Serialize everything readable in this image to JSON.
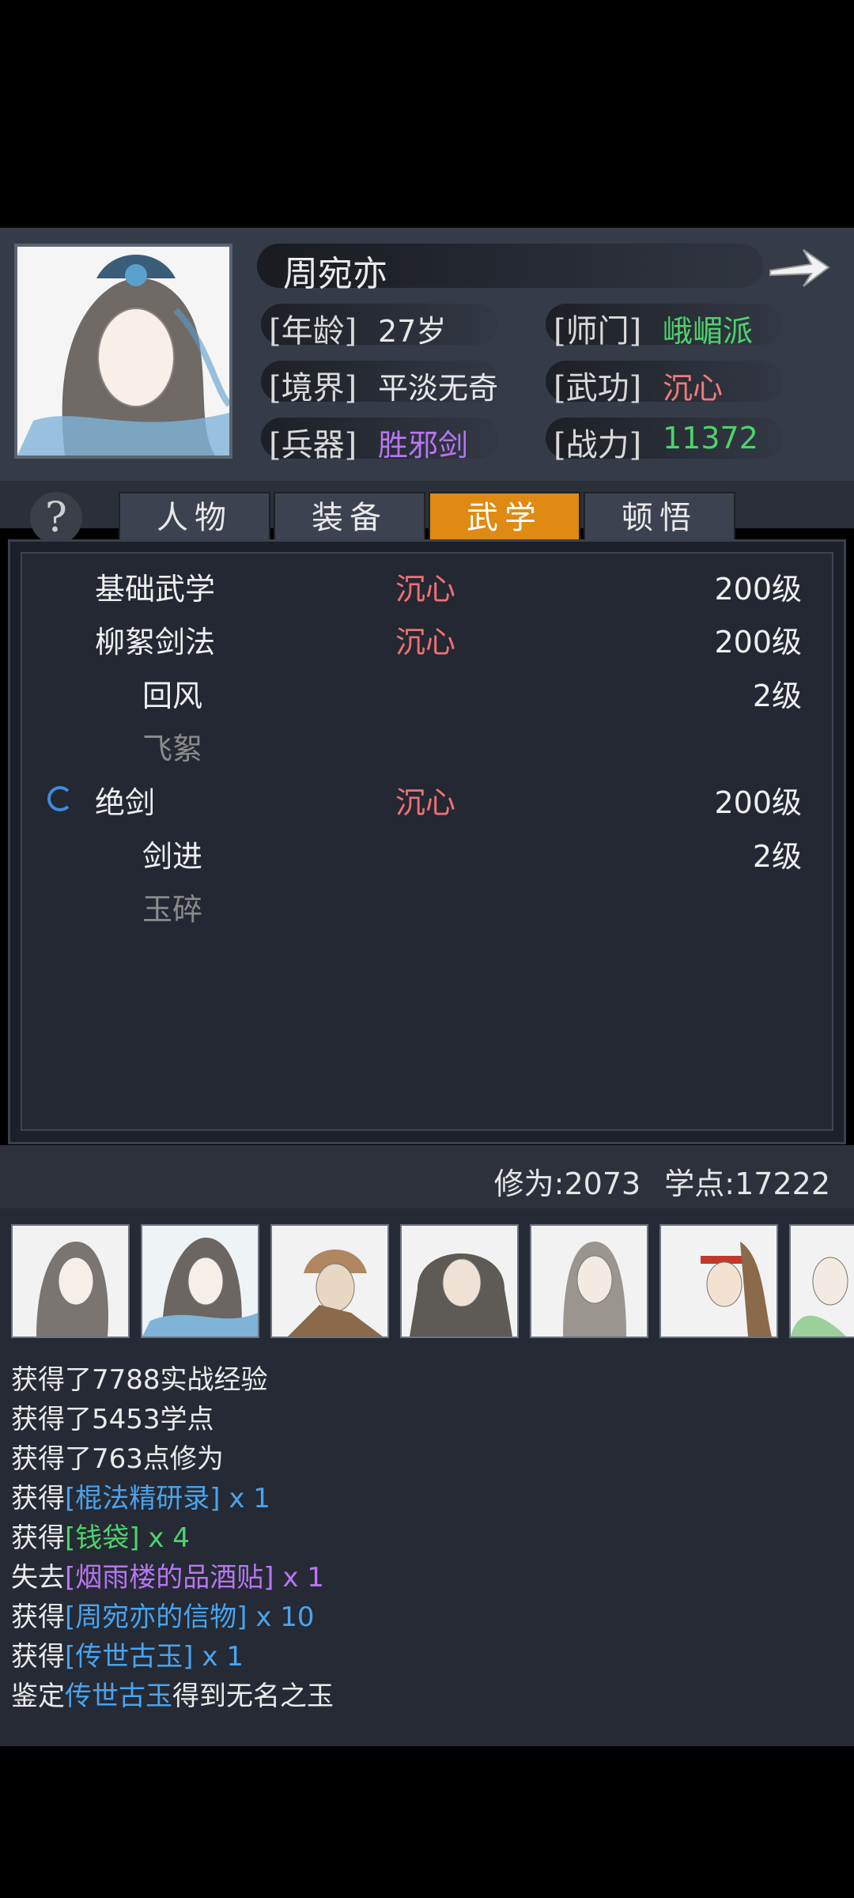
{
  "character": {
    "name": "周宛亦",
    "attributes": [
      {
        "label": "[年龄]",
        "value": "27岁",
        "color": "#e8e8e8"
      },
      {
        "label": "[师门]",
        "value": "峨嵋派",
        "color": "#4dd36b"
      },
      {
        "label": "[境界]",
        "value": "平淡无奇",
        "color": "#e8e8e8"
      },
      {
        "label": "[武功]",
        "value": "沉心",
        "color": "#f07a7a"
      },
      {
        "label": "[兵器]",
        "value": "胜邪剑",
        "color": "#b875f2"
      },
      {
        "label": "[战力]",
        "value": "11372",
        "color": "#4dd36b"
      }
    ]
  },
  "tabs": [
    {
      "label": "人物",
      "active": false
    },
    {
      "label": "装备",
      "active": false
    },
    {
      "label": "武学",
      "active": true
    },
    {
      "label": "顿悟",
      "active": false
    }
  ],
  "help_icon": "question-mark",
  "skills": [
    {
      "name": "基础武学",
      "stance": "沉心",
      "level": "200级",
      "indent": false,
      "dim": false,
      "spinner": false
    },
    {
      "name": "柳絮剑法",
      "stance": "沉心",
      "level": "200级",
      "indent": false,
      "dim": false,
      "spinner": false
    },
    {
      "name": "回风",
      "stance": "",
      "level": "2级",
      "indent": true,
      "dim": false,
      "spinner": false
    },
    {
      "name": "飞絮",
      "stance": "",
      "level": "",
      "indent": true,
      "dim": true,
      "spinner": false
    },
    {
      "name": "绝剑",
      "stance": "沉心",
      "level": "200级",
      "indent": false,
      "dim": false,
      "spinner": true
    },
    {
      "name": "剑进",
      "stance": "",
      "level": "2级",
      "indent": true,
      "dim": false,
      "spinner": false
    },
    {
      "name": "玉碎",
      "stance": "",
      "level": "",
      "indent": true,
      "dim": true,
      "spinner": false
    }
  ],
  "stats": {
    "cultivation_label": "修为:",
    "cultivation": "2073",
    "points_label": "学点:",
    "points": "17222"
  },
  "log": [
    {
      "parts": [
        {
          "t": "获得了7788实战经验",
          "c": "#eaeaea"
        }
      ]
    },
    {
      "parts": [
        {
          "t": "获得了5453学点",
          "c": "#eaeaea"
        }
      ]
    },
    {
      "parts": [
        {
          "t": "获得了763点修为",
          "c": "#eaeaea"
        }
      ]
    },
    {
      "parts": [
        {
          "t": "获得",
          "c": "#eaeaea"
        },
        {
          "t": "[棍法精研录]",
          "c": "#4aa3ee"
        },
        {
          "t": " x 1",
          "c": "#4aa3ee"
        }
      ]
    },
    {
      "parts": [
        {
          "t": "获得",
          "c": "#eaeaea"
        },
        {
          "t": "[钱袋]",
          "c": "#4dd36b"
        },
        {
          "t": " x 4",
          "c": "#4dd36b"
        }
      ]
    },
    {
      "parts": [
        {
          "t": "失去",
          "c": "#eaeaea"
        },
        {
          "t": "[烟雨楼的品酒贴]",
          "c": "#b875f2"
        },
        {
          "t": " x 1",
          "c": "#b875f2"
        }
      ]
    },
    {
      "parts": [
        {
          "t": "获得",
          "c": "#eaeaea"
        },
        {
          "t": "[周宛亦的信物]",
          "c": "#4aa3ee"
        },
        {
          "t": " x 10",
          "c": "#4aa3ee"
        }
      ]
    },
    {
      "parts": [
        {
          "t": "获得",
          "c": "#eaeaea"
        },
        {
          "t": "[传世古玉]",
          "c": "#4aa3ee"
        },
        {
          "t": " x 1",
          "c": "#4aa3ee"
        }
      ]
    },
    {
      "parts": [
        {
          "t": "鉴定",
          "c": "#eaeaea"
        },
        {
          "t": "传世古玉",
          "c": "#4aa3ee"
        },
        {
          "t": "得到无名之玉",
          "c": "#eaeaea"
        }
      ]
    }
  ]
}
